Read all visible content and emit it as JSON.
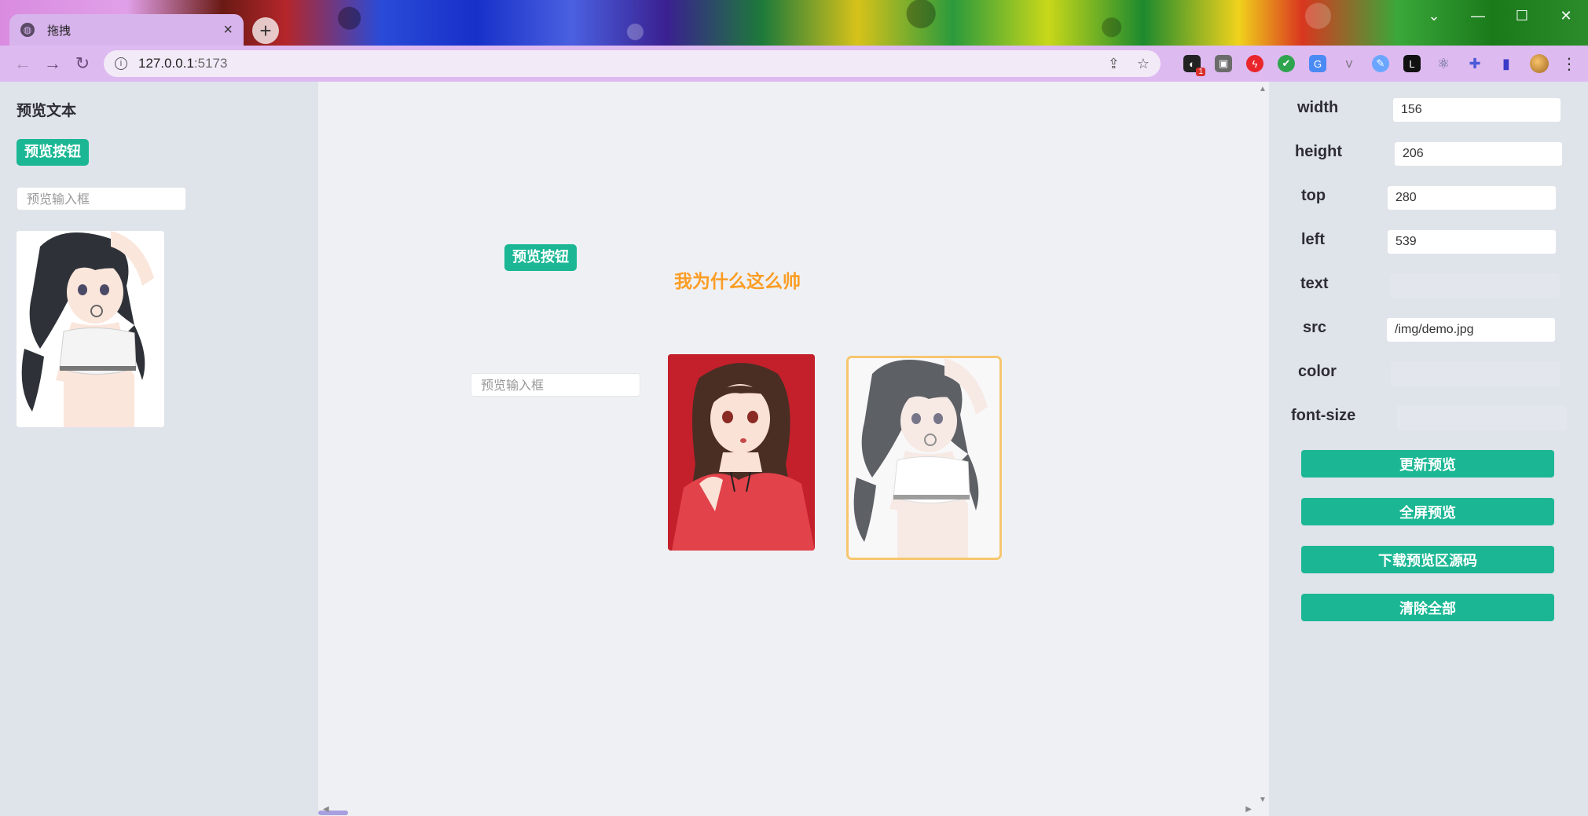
{
  "browser": {
    "tab_title": "拖拽",
    "url_host": "127.0.0.1",
    "url_port": ":5173",
    "ext_badge": "1",
    "ext_letter": "L"
  },
  "left_palette": {
    "text_item": "预览文本",
    "button_item": "预览按钮",
    "input_placeholder": "预览输入框",
    "image_name": "white-top-girl-picture"
  },
  "canvas": {
    "button_label": "预览按钮",
    "heading_text": "我为什么这么帅",
    "input_placeholder": "预览输入框",
    "image_red_name": "red-shirt-girl-picture",
    "image_selected_name": "white-top-girl-picture"
  },
  "properties": {
    "width": {
      "label": "width",
      "value": "156"
    },
    "height": {
      "label": "height",
      "value": "206"
    },
    "top": {
      "label": "top",
      "value": "280"
    },
    "left": {
      "label": "left",
      "value": "539"
    },
    "text": {
      "label": "text",
      "value": ""
    },
    "src": {
      "label": "src",
      "value": "/img/demo.jpg"
    },
    "color": {
      "label": "color",
      "value": ""
    },
    "font_size": {
      "label": "font-size",
      "value": ""
    }
  },
  "actions": {
    "update": "更新预览",
    "fullscreen": "全屏预览",
    "download": "下载预览区源码",
    "clear": "清除全部"
  },
  "colors": {
    "accent": "#1bb794",
    "heading": "#fb9d24",
    "selection": "#f7c66e",
    "panel": "#dfe3ea",
    "canvas": "#eff0f3"
  }
}
